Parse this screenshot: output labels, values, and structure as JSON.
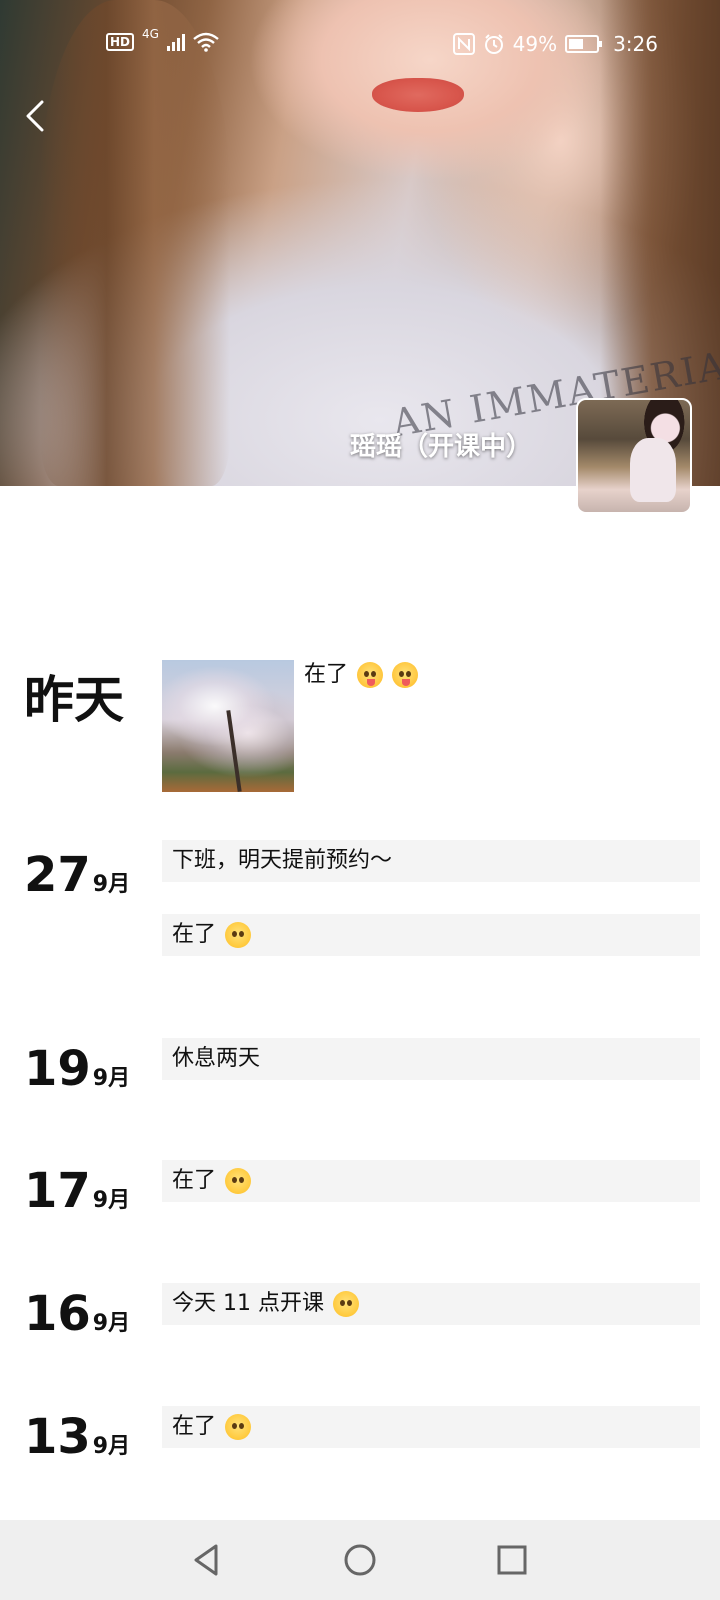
{
  "status_bar": {
    "hd": "HD",
    "network": "4G",
    "battery_percent": "49%",
    "time": "3:26"
  },
  "profile": {
    "name": "瑶瑶（开课中）"
  },
  "cover_image": {
    "shirt_text": "AN IMMATERIAL"
  },
  "timeline": {
    "entries": [
      {
        "date_label": "昨天",
        "text": "在了",
        "emojis": [
          "tongue-wink-emoji",
          "tongue-wink-emoji"
        ],
        "has_photo": true
      },
      {
        "day": "27",
        "month": "9月",
        "messages": [
          "下班，明天提前预约～",
          "在了"
        ]
      },
      {
        "day": "19",
        "month": "9月",
        "messages": [
          "休息两天"
        ]
      },
      {
        "day": "17",
        "month": "9月",
        "messages": [
          "在了"
        ]
      },
      {
        "day": "16",
        "month": "9月",
        "messages": [
          "今天 11 点开课"
        ]
      },
      {
        "day": "13",
        "month": "9月",
        "messages": [
          "在了"
        ]
      }
    ]
  }
}
